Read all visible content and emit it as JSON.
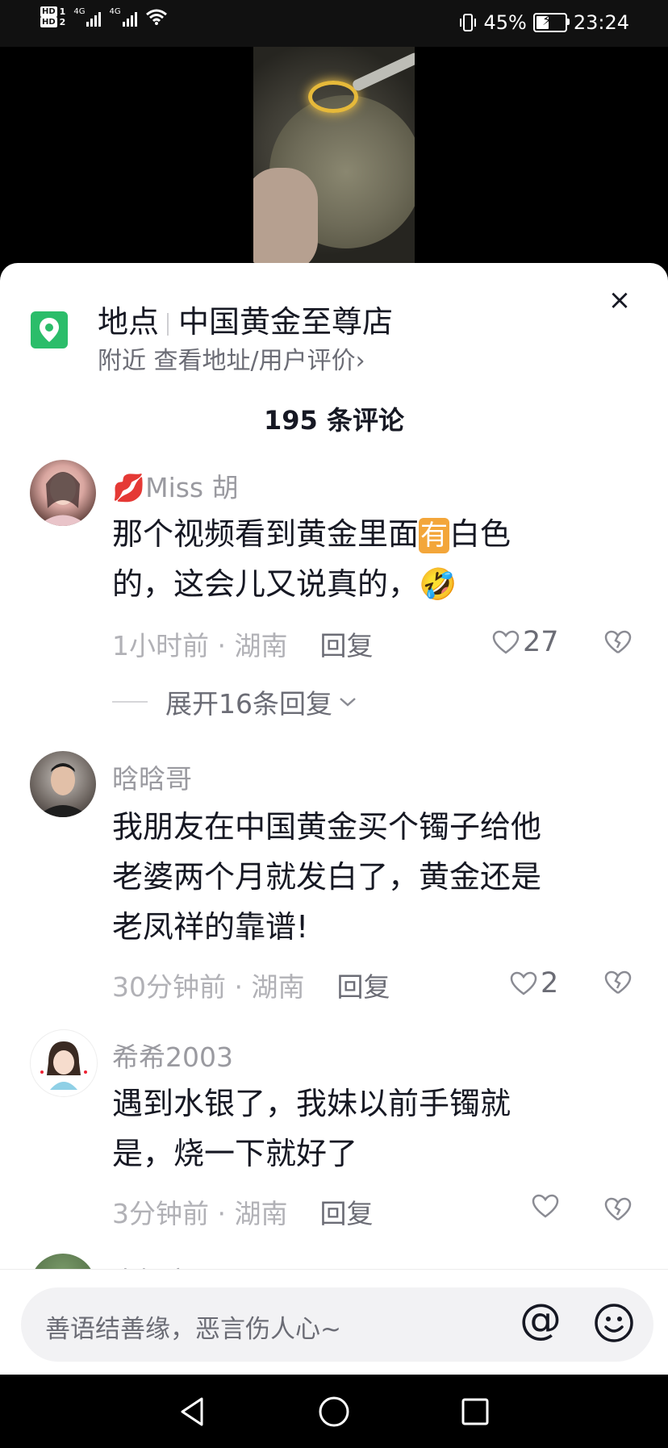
{
  "status_bar": {
    "hd1": "HD",
    "hd1_num": "1",
    "hd2": "HD",
    "hd2_num": "2",
    "net1": "4G",
    "net2": "4G",
    "battery_pct": "45%",
    "time": "23:24",
    "battery_level": 0.45
  },
  "location": {
    "label": "地点",
    "name": "中国黄金至尊店",
    "subtitle": "附近 查看地址/用户评价›",
    "icon": "map-pin-icon"
  },
  "comments_header": {
    "count_text": "195 条评论"
  },
  "comments": [
    {
      "user": "Miss 胡",
      "user_emoji": "💋",
      "text_lines": [
        "那个视频看到黄金里面",
        "有",
        "白色",
        "的，这会儿又说真的，",
        "🤣"
      ],
      "time": "1小时前",
      "region": "湖南",
      "reply_label": "回复",
      "likes": "27",
      "expand_label": "展开16条回复"
    },
    {
      "user": "晗晗哥",
      "text_lines": [
        "我朋友在中国黄金买个镯子给他",
        "老婆两个月就发白了，黄金还是",
        "老凤祥的靠谱!"
      ],
      "time": "30分钟前",
      "region": "湖南",
      "reply_label": "回复",
      "likes": "2"
    },
    {
      "user": "希希2003",
      "text_lines": [
        "遇到水银了，我妹以前手镯就",
        "是，烧一下就好了"
      ],
      "time": "3分钟前",
      "region": "湖南",
      "reply_label": "回复",
      "likes": ""
    }
  ],
  "partial_next_user": "青椰宝贝",
  "input": {
    "placeholder": "善语结善缘，恶言伤人心~",
    "at_label": "@"
  },
  "separator": "·",
  "close_label": "×"
}
